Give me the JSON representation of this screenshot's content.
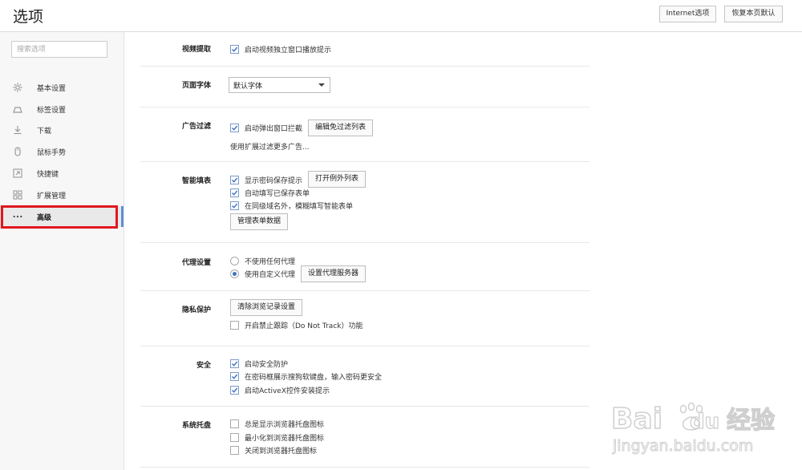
{
  "header": {
    "title": "选项",
    "internet_options": "Internet选项",
    "restore_defaults": "恢复本页默认"
  },
  "sidebar": {
    "search_placeholder": "搜索选项",
    "items": [
      {
        "label": "基本设置",
        "icon": "gear-icon"
      },
      {
        "label": "标签设置",
        "icon": "tab-icon"
      },
      {
        "label": "下载",
        "icon": "download-icon"
      },
      {
        "label": "鼠标手势",
        "icon": "mouse-icon"
      },
      {
        "label": "快捷键",
        "icon": "shortcut-icon"
      },
      {
        "label": "扩展管理",
        "icon": "extensions-icon"
      },
      {
        "label": "高级",
        "icon": "more-icon",
        "active": true
      }
    ]
  },
  "sections": {
    "video": {
      "label": "视频提取",
      "opt1": "启动视频独立窗口播放提示",
      "opt1_checked": true
    },
    "font": {
      "label": "页面字体",
      "selected": "默认字体"
    },
    "adblock": {
      "label": "广告过滤",
      "opt1": "启动弹出窗口拦截",
      "opt1_checked": true,
      "edit_button": "编辑免过滤列表",
      "hint": "使用扩展过滤更多广告..."
    },
    "autofill": {
      "label": "智能填表",
      "opt1": "显示密码保存提示",
      "opt2": "自动填写已保存表单",
      "opt3": "在同级域名外，模糊填写智能表单",
      "opt1_checked": true,
      "opt2_checked": true,
      "opt3_checked": true,
      "exceptions_button": "打开例外列表",
      "manage_button": "管理表单数据"
    },
    "proxy": {
      "label": "代理设置",
      "opt1": "不使用任何代理",
      "opt2": "使用自定义代理",
      "selected": "opt2",
      "server_button": "设置代理服务器"
    },
    "privacy": {
      "label": "隐私保护",
      "clear_button": "清除浏览记录设置",
      "opt1": "开启禁止跟踪（Do Not Track）功能",
      "opt1_checked": false
    },
    "security": {
      "label": "安全",
      "opt1": "启动安全防护",
      "opt2": "在密码框展示搜狗软键盘，输入密码更安全",
      "opt3": "启动ActiveX控件安装提示",
      "opt1_checked": true,
      "opt2_checked": true,
      "opt3_checked": true
    },
    "tray": {
      "label": "系统托盘",
      "opt1": "总是显示浏览器托盘图标",
      "opt2": "最小化到浏览器托盘图标",
      "opt3": "关闭到浏览器托盘图标",
      "opt1_checked": false,
      "opt2_checked": false,
      "opt3_checked": false
    }
  },
  "watermark": {
    "brand": "Bai",
    "brand2": "du",
    "jingyan": "经验",
    "url": "jingyan.baidu.com"
  },
  "colors": {
    "accent": "#3a73c8",
    "highlight": "#e0181e"
  }
}
